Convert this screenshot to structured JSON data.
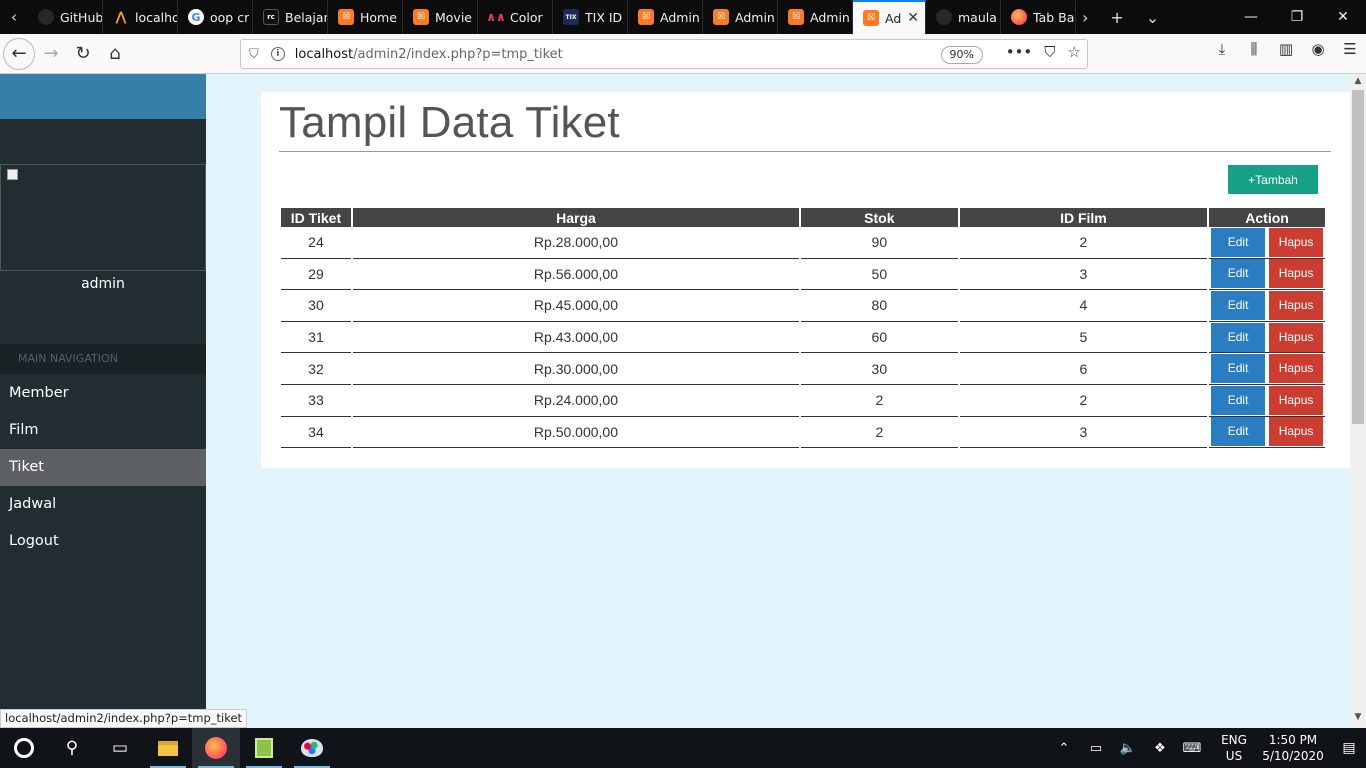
{
  "browser": {
    "tabs": [
      {
        "label": "GitHub",
        "favicon": "github-icon"
      },
      {
        "label": "localhost",
        "favicon": "mountain-icon"
      },
      {
        "label": "oop cr",
        "favicon": "google-icon"
      },
      {
        "label": "Belajar",
        "favicon": "rc-icon"
      },
      {
        "label": "Home",
        "favicon": "xampp-icon"
      },
      {
        "label": "Movie",
        "favicon": "xampp-icon"
      },
      {
        "label": "Color",
        "favicon": "color-icon"
      },
      {
        "label": "TIX ID",
        "favicon": "tix-icon"
      },
      {
        "label": "Admin",
        "favicon": "xampp-icon"
      },
      {
        "label": "Admin",
        "favicon": "xampp-icon"
      },
      {
        "label": "Admin",
        "favicon": "xampp-icon"
      },
      {
        "label": "Ad",
        "favicon": "xampp-icon",
        "active": true
      },
      {
        "label": "maula",
        "favicon": "github-icon"
      },
      {
        "label": "Tab Ba",
        "favicon": "firefox-icon"
      }
    ],
    "url_host": "localhost",
    "url_path": "/admin2/index.php?p=tmp_tiket",
    "zoom": "90%",
    "status_url": "localhost/admin2/index.php?p=tmp_tiket"
  },
  "sidebar": {
    "username": "admin",
    "nav_header": "MAIN NAVIGATION",
    "items": [
      {
        "label": "Member"
      },
      {
        "label": "Film"
      },
      {
        "label": "Tiket",
        "active": true
      },
      {
        "label": "Jadwal"
      },
      {
        "label": "Logout"
      }
    ]
  },
  "main": {
    "title": "Tampil Data Tiket",
    "add_button": "+Tambah",
    "table": {
      "headers": [
        "ID Tiket",
        "Harga",
        "Stok",
        "ID Film",
        "Action"
      ],
      "edit_label": "Edit",
      "delete_label": "Hapus",
      "rows": [
        {
          "id": "24",
          "harga": "Rp.28.000,00",
          "stok": "90",
          "id_film": "2"
        },
        {
          "id": "29",
          "harga": "Rp.56.000,00",
          "stok": "50",
          "id_film": "3"
        },
        {
          "id": "30",
          "harga": "Rp.45.000,00",
          "stok": "80",
          "id_film": "4"
        },
        {
          "id": "31",
          "harga": "Rp.43.000,00",
          "stok": "60",
          "id_film": "5"
        },
        {
          "id": "32",
          "harga": "Rp.30.000,00",
          "stok": "30",
          "id_film": "6"
        },
        {
          "id": "33",
          "harga": "Rp.24.000,00",
          "stok": "2",
          "id_film": "2"
        },
        {
          "id": "34",
          "harga": "Rp.50.000,00",
          "stok": "2",
          "id_film": "3"
        }
      ]
    }
  },
  "taskbar": {
    "lang_line1": "ENG",
    "lang_line2": "US",
    "time": "1:50 PM",
    "date": "5/10/2020"
  },
  "colors": {
    "sidebar_bg": "#222d32",
    "logo_bar": "#367fa9",
    "content_bg": "#e2f4fc",
    "add_button": "#16a085",
    "edit_button": "#2a7dc0",
    "delete_button": "#cc3d31",
    "table_header": "#454545"
  }
}
